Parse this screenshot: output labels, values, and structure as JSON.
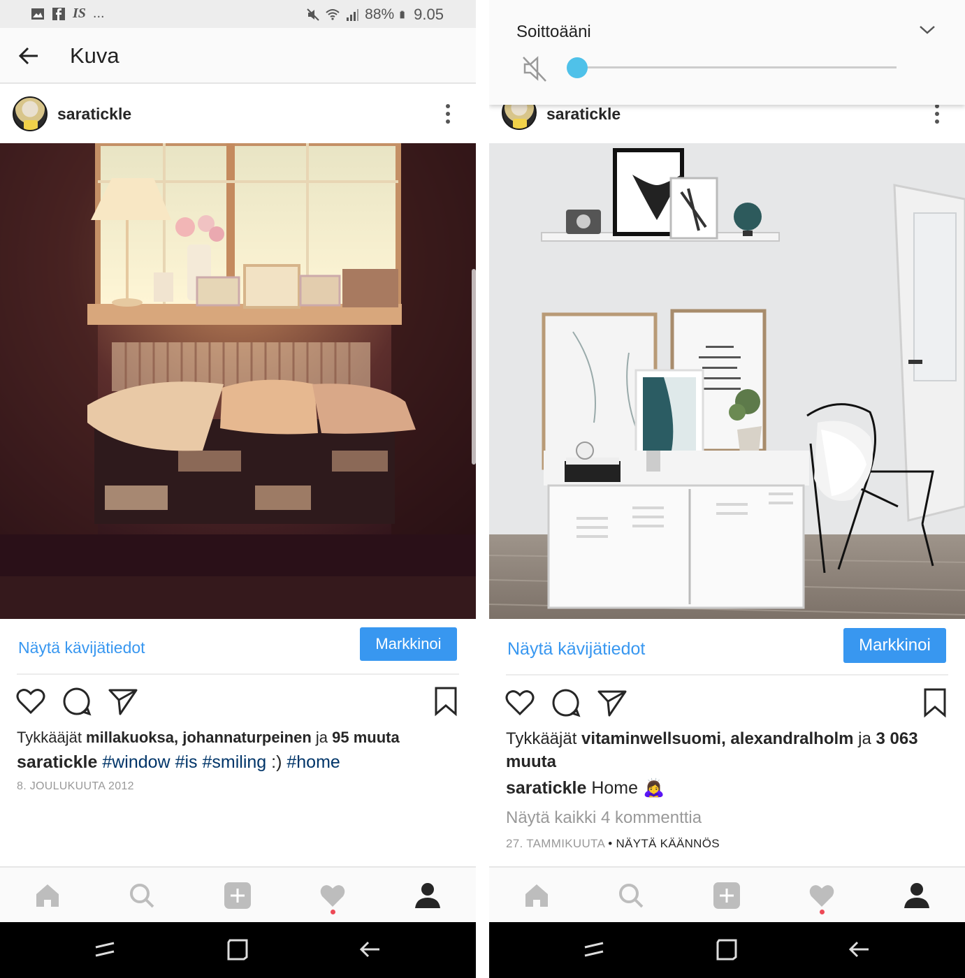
{
  "left": {
    "status_bar": {
      "left_icons": [
        "image-icon",
        "facebook-icon",
        "is-app-icon"
      ],
      "is_label": "IS",
      "more": "...",
      "right_icons": [
        "mute-icon",
        "wifi-icon",
        "signal-icon",
        "battery-icon"
      ],
      "battery": "88%",
      "time": "9.05"
    },
    "app_bar": {
      "title": "Kuva"
    },
    "post": {
      "username": "saratickle",
      "insights_link": "Näytä kävijätiedot",
      "promote_label": "Markkinoi",
      "likes_prefix": "Tykkääjät ",
      "likes_users": "millakuoksa, johannaturpeinen",
      "likes_mid": " ja ",
      "likes_count": "95 muuta",
      "caption_user": "saratickle",
      "caption_parts": [
        {
          "text": "#window",
          "tag": true
        },
        {
          "text": " ",
          "tag": false
        },
        {
          "text": "#is",
          "tag": true
        },
        {
          "text": " ",
          "tag": false
        },
        {
          "text": "#smiling",
          "tag": true
        },
        {
          "text": " :) ",
          "tag": false
        },
        {
          "text": "#home",
          "tag": true
        }
      ],
      "date": "8. JOULUKUUTA 2012"
    }
  },
  "right": {
    "volume_panel": {
      "title": "Soittoääni",
      "level": 0
    },
    "post": {
      "username": "saratickle",
      "insights_link": "Näytä kävijätiedot",
      "promote_label": "Markkinoi",
      "likes_prefix": "Tykkääjät ",
      "likes_users": "vitaminwellsuomi, alexandralholm",
      "likes_mid": " ja ",
      "likes_count": "3 063 muuta",
      "caption_user": "saratickle",
      "caption_text": " Home 🙇‍♀️",
      "view_comments": "Näytä kaikki 4 kommenttia",
      "date": "27. TAMMIKUUTA",
      "date_sep": " • ",
      "translate": "NÄYTÄ KÄÄNNÖS"
    }
  },
  "tab_bar": [
    "home-icon",
    "search-icon",
    "add-post-icon",
    "activity-heart-icon",
    "profile-icon"
  ],
  "nav_bar": [
    "recent-apps-icon",
    "home-square-icon",
    "back-icon"
  ],
  "colors": {
    "link": "#3897f0",
    "hashtag": "#003569",
    "notif": "#ed4956",
    "volume_thumb": "#4fc1e9"
  }
}
